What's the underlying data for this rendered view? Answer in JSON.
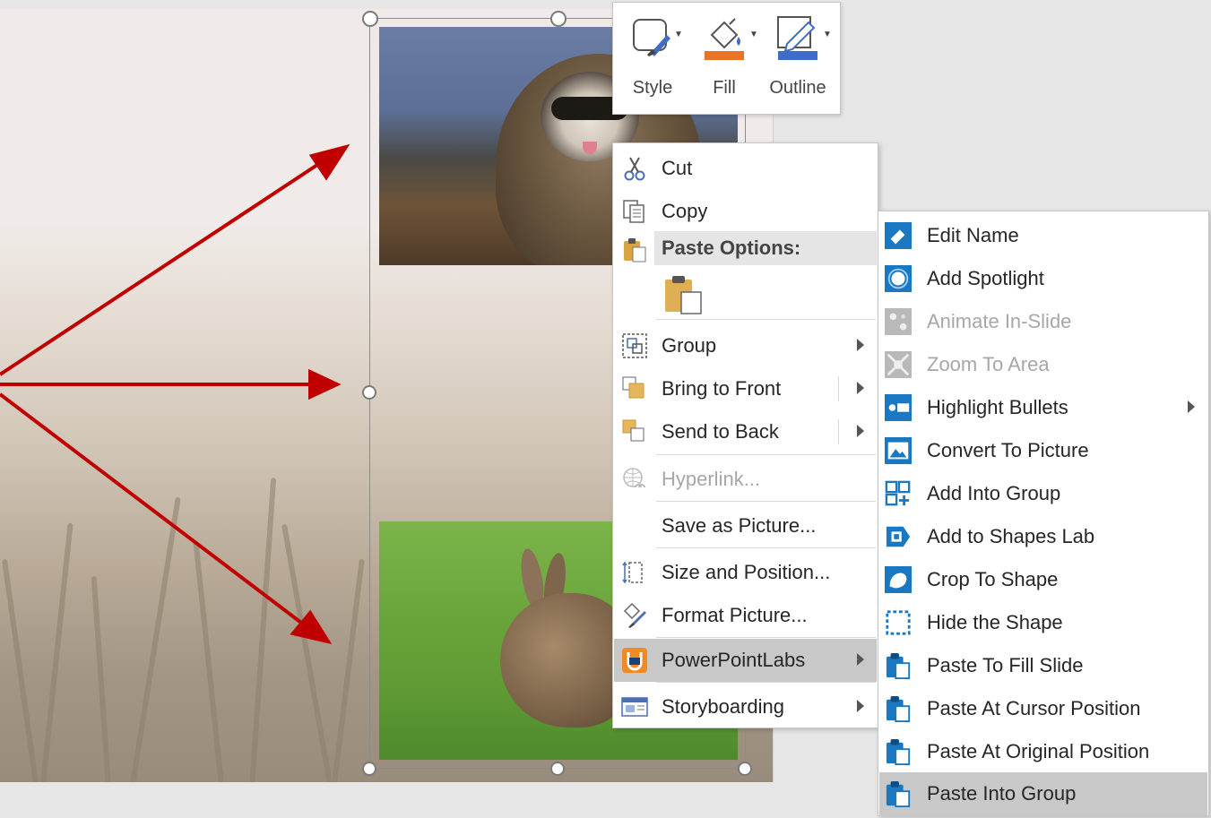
{
  "mini_toolbar": {
    "style_label": "Style",
    "fill_label": "Fill",
    "outline_label": "Outline",
    "fill_color": "#e8742a",
    "outline_color": "#3f6cc5"
  },
  "context_menu": {
    "cut": "Cut",
    "copy": "Copy",
    "paste_options": "Paste Options:",
    "group": "Group",
    "bring_to_front": "Bring to Front",
    "send_to_back": "Send to Back",
    "hyperlink": "Hyperlink...",
    "save_as_picture": "Save as Picture...",
    "size_and_position": "Size and Position...",
    "format_picture": "Format Picture...",
    "powerpointlabs": "PowerPointLabs",
    "storyboarding": "Storyboarding"
  },
  "submenu": {
    "items": [
      {
        "label": "Edit Name"
      },
      {
        "label": "Add Spotlight"
      },
      {
        "label": "Animate In-Slide"
      },
      {
        "label": "Zoom To Area"
      },
      {
        "label": "Highlight Bullets"
      },
      {
        "label": "Convert To Picture"
      },
      {
        "label": "Add Into Group"
      },
      {
        "label": "Add to Shapes Lab"
      },
      {
        "label": "Crop To Shape"
      },
      {
        "label": "Hide the Shape"
      },
      {
        "label": "Paste To Fill Slide"
      },
      {
        "label": "Paste At Cursor Position"
      },
      {
        "label": "Paste At Original Position"
      },
      {
        "label": "Paste Into Group"
      }
    ]
  },
  "colors": {
    "arrow": "#c00000",
    "ppl_icon_blue": "#1a78c2",
    "ppl_logo_orange": "#f08a24",
    "hover": "#c8c8c8"
  }
}
